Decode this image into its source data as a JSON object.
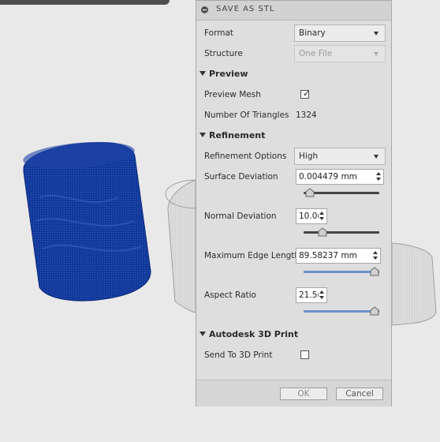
{
  "dialog": {
    "title": "SAVE AS STL",
    "format": {
      "label": "Format",
      "value": "Binary"
    },
    "structure": {
      "label": "Structure",
      "value": "One File"
    },
    "preview": {
      "header": "Preview",
      "mesh_label": "Preview Mesh",
      "mesh_checked": true,
      "triangles_label": "Number Of Triangles",
      "triangles_value": "1324"
    },
    "refinement": {
      "header": "Refinement",
      "options_label": "Refinement Options",
      "options_value": "High",
      "surface_label": "Surface Deviation",
      "surface_value": "0.004479 mm",
      "surface_slider_position": 0.02,
      "normal_label": "Normal Deviation",
      "normal_value": "10.0(",
      "normal_slider_position": 0.22,
      "edge_label": "Maximum Edge Length",
      "edge_value": "89.58237 mm",
      "edge_slider_position": 1.0,
      "aspect_label": "Aspect Ratio",
      "aspect_value": "21.5(",
      "aspect_slider_position": 1.0
    },
    "print3d": {
      "header": "Autodesk 3D Print",
      "send_label": "Send To 3D Print",
      "send_checked": false
    },
    "ok_label": "OK",
    "cancel_label": "Cancel"
  },
  "colors": {
    "mesh_blue": "#12399a",
    "slider_fill": "#6f8fc8",
    "canvas_bg": "#e9e9e9",
    "panel_bg": "#dedede"
  }
}
